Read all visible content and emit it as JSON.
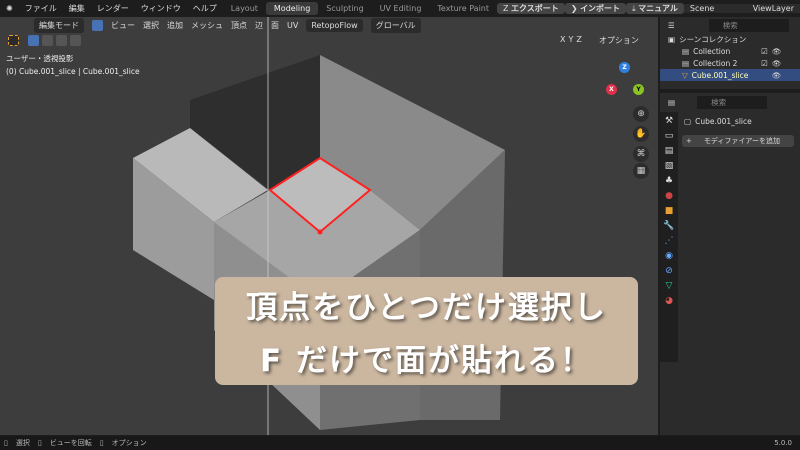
{
  "menu": [
    "ファイル",
    "編集",
    "レンダー",
    "ウィンドウ",
    "ヘルプ"
  ],
  "workspaces": [
    "Layout",
    "Modeling",
    "Sculpting",
    "UV Editing",
    "Texture Paint"
  ],
  "active_workspace": "Modeling",
  "header_buttons": {
    "export": "エクスポート",
    "import": "インポート",
    "manual": "マニュアル",
    "scene": "Scene",
    "view_layer": "ViewLayer"
  },
  "viewport_header": {
    "mode": "編集モード",
    "items": [
      "ビュー",
      "選択",
      "追加",
      "メッシュ",
      "頂点",
      "辺",
      "面",
      "UV"
    ],
    "addon": "RetopoFlow",
    "orientation": "グローバル",
    "options": "オプション",
    "axes": [
      "X",
      "Y",
      "Z"
    ]
  },
  "overlay": {
    "view": "ユーザー・透視投影",
    "object": "(0) Cube.001_slice | Cube.001_slice"
  },
  "caption": {
    "line1": "頂点をひとつだけ選択し",
    "line2": "F だけで面が貼れる！"
  },
  "gizmo": {
    "x": "X",
    "y": "Y",
    "z": "Z"
  },
  "outliner": {
    "search_placeholder": "検索",
    "scene_collection": "シーンコレクション",
    "items": [
      {
        "name": "Collection",
        "selected": false
      },
      {
        "name": "Collection 2",
        "selected": false
      },
      {
        "name": "Cube.001_slice",
        "selected": true
      }
    ]
  },
  "properties": {
    "search_placeholder": "検索",
    "object": "Cube.001_slice",
    "add_modifier": "モディファイアーを追加"
  },
  "status": {
    "select": "選択",
    "rotate": "ビューを回転",
    "options": "オプション",
    "version": "5.0.0"
  },
  "colors": {
    "accent": "#4772b3",
    "selection": "#ff0000",
    "caption_bg": "#cbb7a0"
  }
}
